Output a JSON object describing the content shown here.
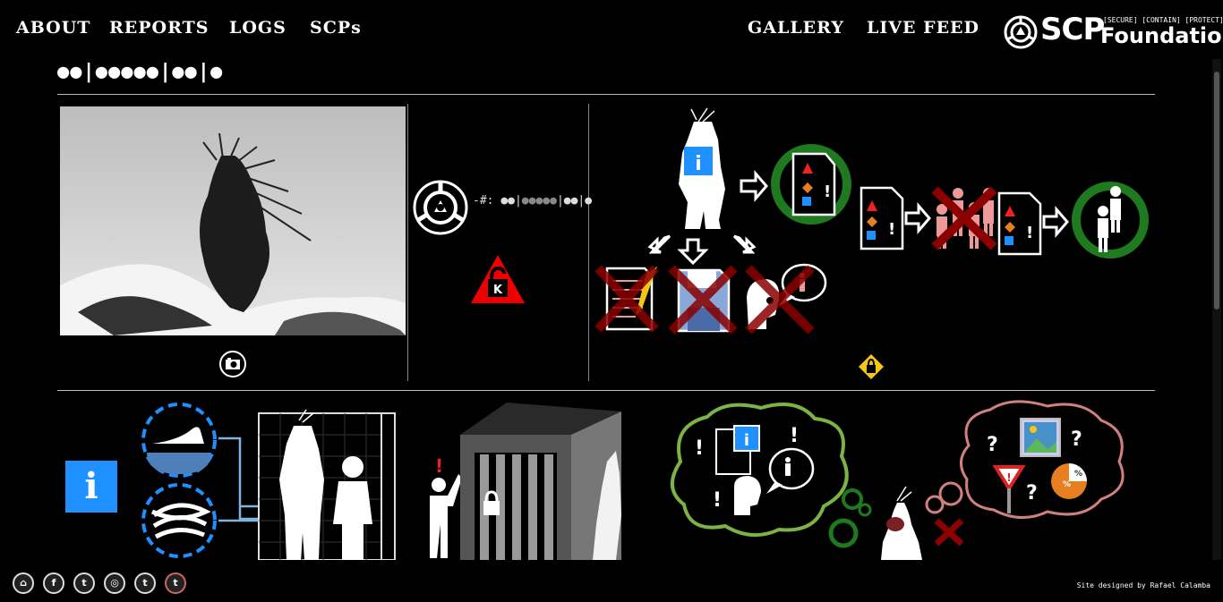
{
  "nav": {
    "left": [
      "ABOUT",
      "REPORTS",
      "LOGS",
      "SCPs"
    ],
    "right": [
      "GALLERY",
      "LIVE FEED"
    ]
  },
  "logo": {
    "scp": "SCP",
    "tagline": "[SECURE] [CONTAIN] [PROTECT]",
    "foundation": "Foundation"
  },
  "page": {
    "title": "●●|●●●●●|●●|●",
    "item_number_prefix": "-#:",
    "item_number_bright": "●●|",
    "item_number_dim": "●●●●●",
    "item_number_tail": "|●●|●",
    "object_class_letter": "K"
  },
  "footer": {
    "credit": "Site designed by Rafael Calamba",
    "social": [
      "scp-icon",
      "facebook-icon",
      "twitter-icon",
      "wikidot-icon",
      "tumblr-icon",
      "tumblr-alt-icon"
    ],
    "social_glyphs": [
      "⌂",
      "f",
      "t",
      "◎",
      "t",
      "t"
    ]
  },
  "colors": {
    "background": "#000000",
    "info_blue": "#1e90ff",
    "safe_green": "#1f7a1f",
    "danger_red": "#8b0000",
    "warning_yellow": "#f5c518",
    "thought_green": "#7cb342",
    "thought_pink": "#d08080"
  }
}
